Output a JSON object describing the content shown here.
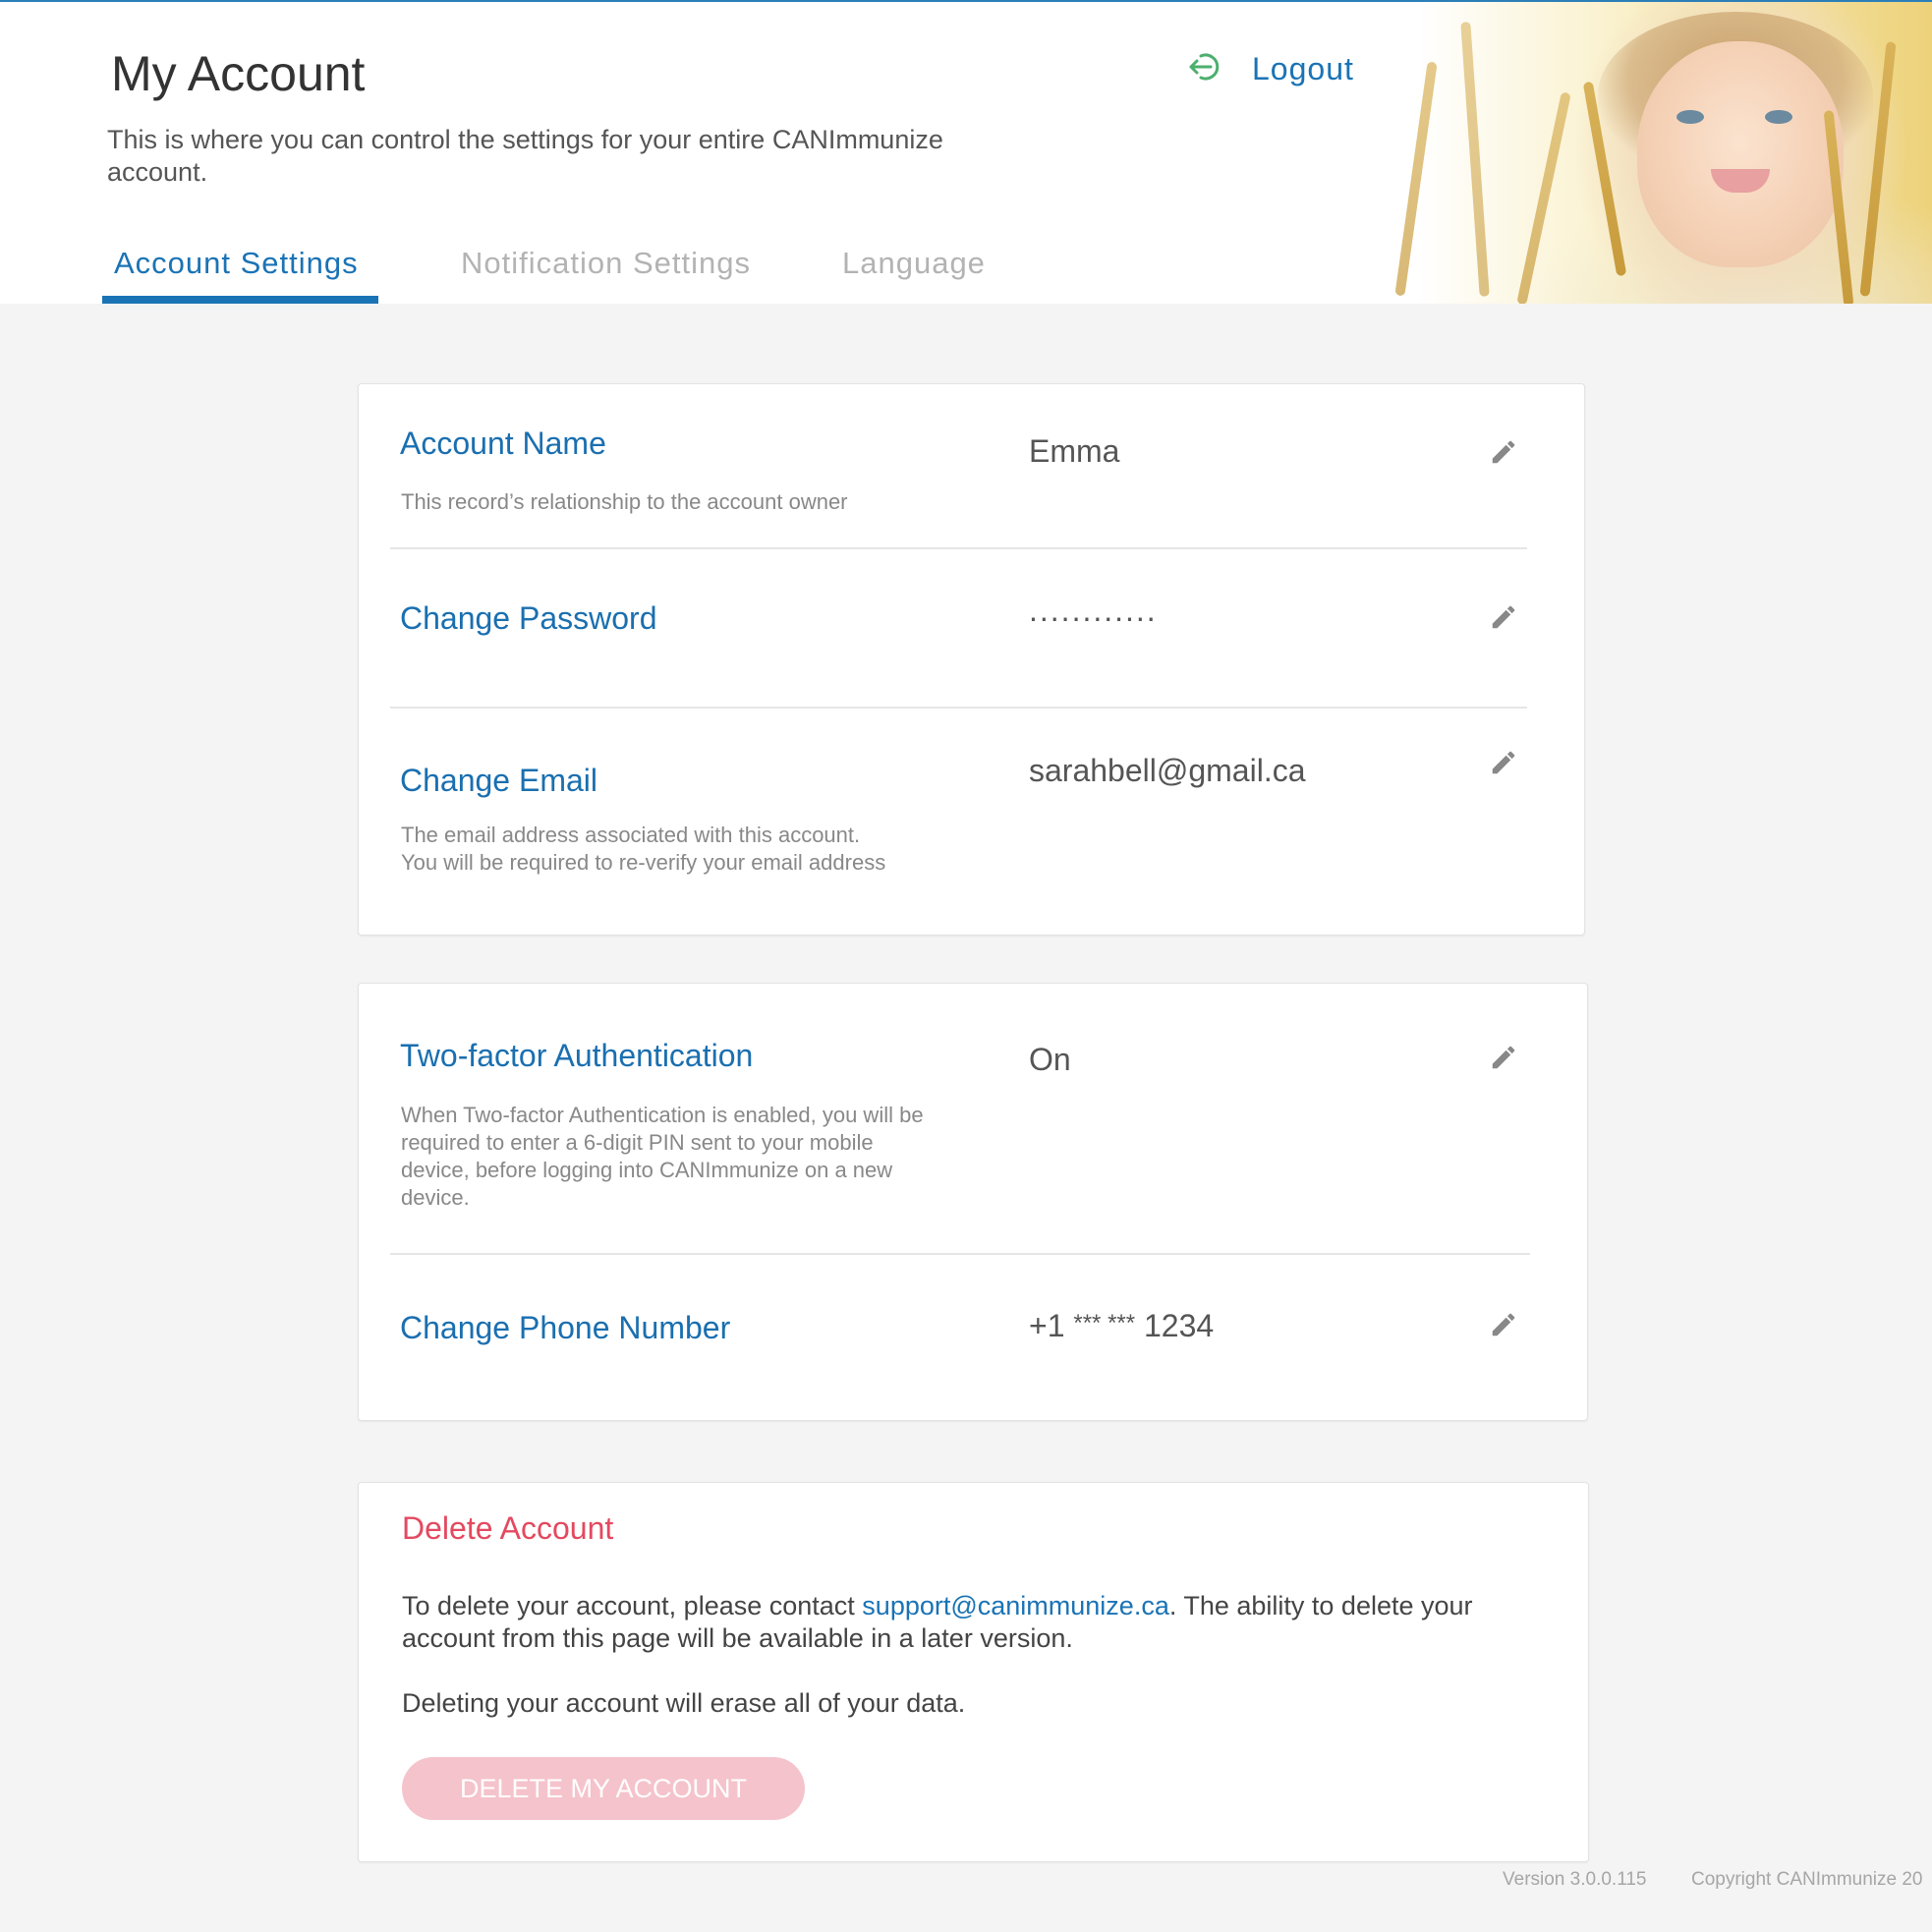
{
  "header": {
    "title": "My Account",
    "subtitle": "This is where you can control the settings for your entire CANImmunize account.",
    "logout_label": "Logout"
  },
  "tabs": [
    {
      "label": "Account Settings",
      "active": true
    },
    {
      "label": "Notification Settings",
      "active": false
    },
    {
      "label": "Language",
      "active": false
    }
  ],
  "account_card": {
    "rows": [
      {
        "title": "Account Name",
        "description": "This record’s relationship to the account owner",
        "value": "Emma"
      },
      {
        "title": "Change Password",
        "description": "",
        "value": "............"
      },
      {
        "title": "Change Email",
        "description_lines": [
          "The email address associated with this account.",
          "You will be required to re-verify your email address"
        ],
        "value": "sarahbell@gmail.ca"
      }
    ]
  },
  "security_card": {
    "rows": [
      {
        "title": "Two-factor Authentication",
        "description": "When Two-factor Authentication is enabled, you will be required to enter a 6-digit PIN sent to your mobile device, before logging into CANImmunize on a new device.",
        "value": "On"
      },
      {
        "title": "Change Phone Number",
        "value_prefix": "+1",
        "value_masked": "*** ***",
        "value_suffix": "1234"
      }
    ]
  },
  "delete_card": {
    "title": "Delete Account",
    "paragraph1_before": "To delete your account, please contact ",
    "support_email": "support@canimmunize.ca",
    "paragraph1_after": ". The ability to delete your account from this page will be available in a later version.",
    "paragraph2": "Deleting your account will erase all of your data.",
    "button_label": "DELETE MY ACCOUNT"
  },
  "footer": {
    "version": "Version 3.0.0.115",
    "copyright": "Copyright CANImmunize 20"
  },
  "colors": {
    "accent": "#1a73b5",
    "danger": "#e4495f",
    "danger_disabled": "#f5c3cb",
    "logout_icon": "#4caf6e"
  },
  "icons": {
    "logout": "logout-arrow-icon",
    "edit": "pencil-icon"
  }
}
